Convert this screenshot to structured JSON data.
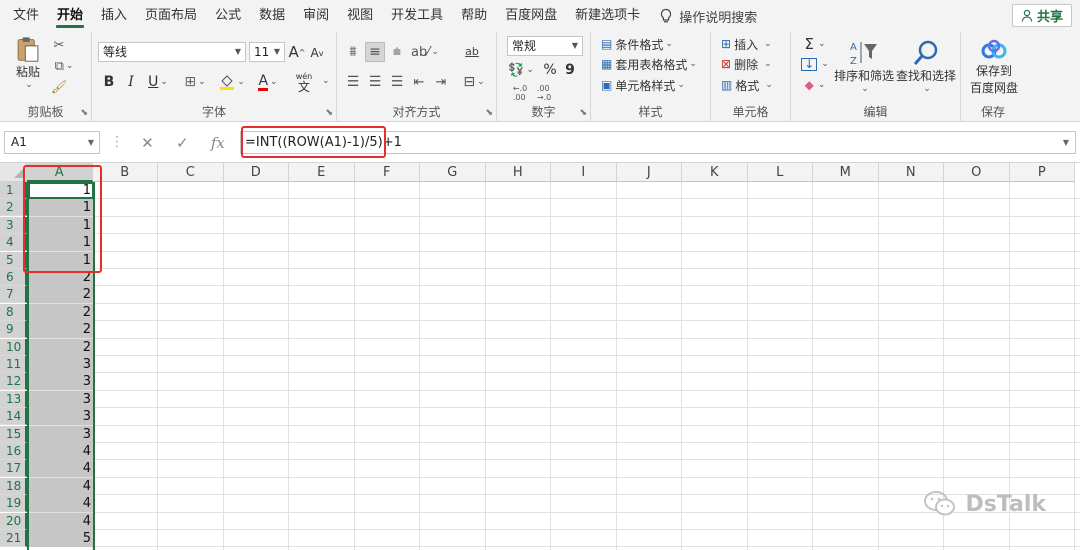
{
  "menu": {
    "tabs": [
      "文件",
      "开始",
      "插入",
      "页面布局",
      "公式",
      "数据",
      "审阅",
      "视图",
      "开发工具",
      "帮助",
      "百度网盘",
      "新建选项卡"
    ],
    "active_tab": "开始",
    "tell_me": "操作说明搜索",
    "share": "共享"
  },
  "ribbon": {
    "clipboard": {
      "paste": "粘贴",
      "label": "剪贴板"
    },
    "font": {
      "name": "等线",
      "size": "11",
      "bold": "B",
      "italic": "I",
      "underline": "U",
      "grow": "A",
      "shrink": "A",
      "font_color": "A",
      "phonetic": "wén",
      "phonetic_char": "文",
      "label": "字体"
    },
    "alignment": {
      "label": "对齐方式",
      "wrap": "ab"
    },
    "number": {
      "format": "常规",
      "percent": "%",
      "comma": "9",
      "label": "数字"
    },
    "styles": {
      "conditional": "条件格式",
      "table": "套用表格格式",
      "cell": "单元格样式",
      "label": "样式"
    },
    "cells": {
      "insert": "插入",
      "delete": "删除",
      "format": "格式",
      "label": "单元格"
    },
    "editing": {
      "sum": "Σ",
      "sort_filter": "排序和筛选",
      "find_select": "查找和选择",
      "label": "编辑"
    },
    "save": {
      "button_line1": "保存到",
      "button_line2": "百度网盘",
      "label": "保存"
    }
  },
  "formula_bar": {
    "name_box": "A1",
    "cancel": "✕",
    "enter": "✓",
    "fx": "fx",
    "formula": "=INT((ROW(A1)-1)/5)+1"
  },
  "sheet": {
    "columns": [
      "A",
      "B",
      "C",
      "D",
      "E",
      "F",
      "G",
      "H",
      "I",
      "J",
      "K",
      "L",
      "M",
      "N",
      "O",
      "P"
    ],
    "rows": [
      "1",
      "2",
      "3",
      "4",
      "5",
      "6",
      "7",
      "8",
      "9",
      "10",
      "11",
      "12",
      "13",
      "14",
      "15",
      "16",
      "17",
      "18",
      "19",
      "20",
      "21"
    ],
    "col_a_values": [
      "1",
      "1",
      "1",
      "1",
      "1",
      "2",
      "2",
      "2",
      "2",
      "2",
      "3",
      "3",
      "3",
      "3",
      "3",
      "4",
      "4",
      "4",
      "4",
      "4",
      "5"
    ]
  },
  "watermark": "DsTalk",
  "colors": {
    "excel_green": "#217346",
    "highlight_red": "#e62e2e"
  }
}
